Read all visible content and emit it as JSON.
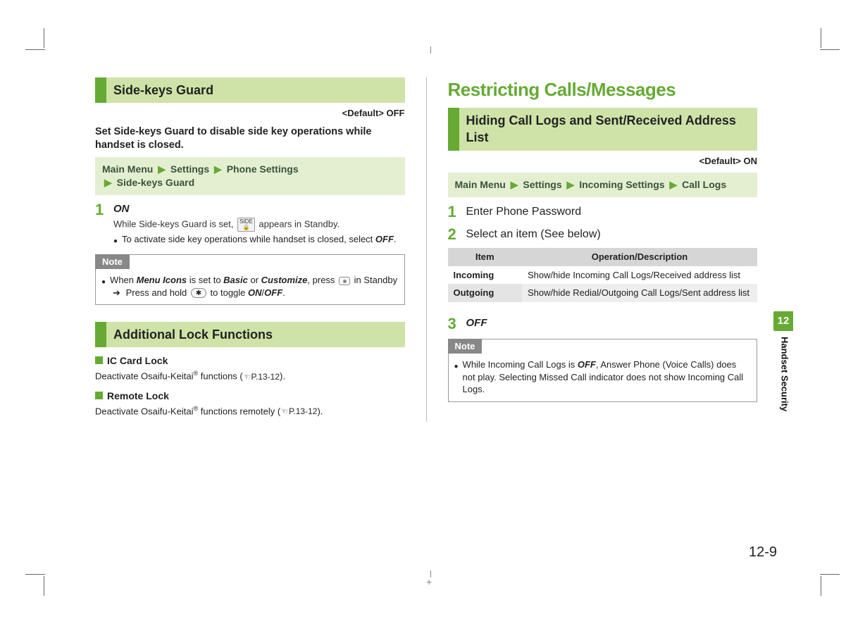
{
  "left": {
    "section1_title": "Side-keys Guard",
    "default": "<Default> OFF",
    "intro": "Set Side-keys Guard to disable side key operations while handset is closed.",
    "nav": [
      "Main Menu",
      "Settings",
      "Phone Settings",
      "Side-keys Guard"
    ],
    "step1_num": "1",
    "step1_head": "ON",
    "step1_line_a": "While Side-keys Guard is set, ",
    "step1_line_b": " appears in Standby.",
    "side_icon_top": "SIDE",
    "side_icon_bot": "🔒",
    "step1_bullet_a": "To activate side key operations while handset is closed, select ",
    "step1_bullet_b": "OFF",
    "step1_bullet_c": ".",
    "note_label": "Note",
    "note_a": "When ",
    "note_b": "Menu Icons",
    "note_c": " is set to ",
    "note_d": "Basic",
    "note_e": " or ",
    "note_f": "Customize",
    "note_g": ", press ",
    "note_h": " in Standby ",
    "note_i": " Press and hold ",
    "star": "✱",
    "note_j": " to toggle ",
    "note_k": "ON",
    "note_slash": "/",
    "note_l": "OFF",
    "note_m": ".",
    "section2_title": "Additional Lock Functions",
    "ic_head": "IC Card Lock",
    "ic_body_a": "Deactivate Osaifu-Keitai",
    "ic_body_b": " functions (",
    "ic_ref": "P.13-12",
    "ic_body_c": ").",
    "rl_head": "Remote Lock",
    "rl_body_a": "Deactivate Osaifu-Keitai",
    "rl_body_b": " functions remotely (",
    "rl_ref": "P.13-12",
    "rl_body_c": ")."
  },
  "right": {
    "big_title": "Restricting Calls/Messages",
    "section_title": "Hiding Call Logs and Sent/Received Address List",
    "default": "<Default> ON",
    "nav": [
      "Main Menu",
      "Settings",
      "Incoming Settings",
      "Call Logs"
    ],
    "s1_num": "1",
    "s1_text": "Enter Phone Password",
    "s2_num": "2",
    "s2_text": "Select an item (See below)",
    "th1": "Item",
    "th2": "Operation/Description",
    "r1c1": "Incoming",
    "r1c2": "Show/hide Incoming Call Logs/Received address list",
    "r2c1": "Outgoing",
    "r2c2": "Show/hide Redial/Outgoing Call Logs/Sent address list",
    "s3_num": "3",
    "s3_head": "OFF",
    "note_label": "Note",
    "note_a": "While Incoming Call Logs is ",
    "note_b": "OFF",
    "note_c": ", Answer Phone (Voice Calls) does not play. Selecting Missed Call indicator does not show Incoming Call Logs."
  },
  "side": {
    "chapter": "12",
    "label": "Handset Security"
  },
  "page_num": "12-9"
}
